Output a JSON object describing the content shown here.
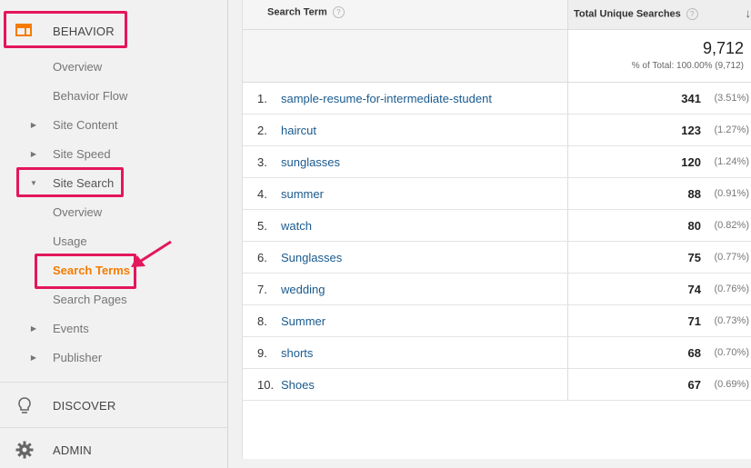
{
  "sidebar": {
    "behavior_label": "BEHAVIOR",
    "items": {
      "overview": "Overview",
      "behavior_flow": "Behavior Flow",
      "site_content": "Site Content",
      "site_speed": "Site Speed",
      "site_search": "Site Search",
      "ss_overview": "Overview",
      "usage": "Usage",
      "search_terms": "Search Terms",
      "search_pages": "Search Pages",
      "events": "Events",
      "publisher": "Publisher"
    },
    "discover_label": "DISCOVER",
    "admin_label": "ADMIN"
  },
  "table": {
    "col_term": "Search Term",
    "col_searches": "Total Unique Searches",
    "total_value": "9,712",
    "total_pct": "% of Total: 100.00% (9,712)",
    "rows": [
      {
        "idx": "1.",
        "term": "sample-resume-for-intermediate-student",
        "value": "341",
        "pct": "(3.51%)"
      },
      {
        "idx": "2.",
        "term": "haircut",
        "value": "123",
        "pct": "(1.27%)"
      },
      {
        "idx": "3.",
        "term": "sunglasses",
        "value": "120",
        "pct": "(1.24%)"
      },
      {
        "idx": "4.",
        "term": "summer",
        "value": "88",
        "pct": "(0.91%)"
      },
      {
        "idx": "5.",
        "term": "watch",
        "value": "80",
        "pct": "(0.82%)"
      },
      {
        "idx": "6.",
        "term": "Sunglasses",
        "value": "75",
        "pct": "(0.77%)"
      },
      {
        "idx": "7.",
        "term": "wedding",
        "value": "74",
        "pct": "(0.76%)"
      },
      {
        "idx": "8.",
        "term": "Summer",
        "value": "71",
        "pct": "(0.73%)"
      },
      {
        "idx": "9.",
        "term": "shorts",
        "value": "68",
        "pct": "(0.70%)"
      },
      {
        "idx": "10.",
        "term": "Shoes",
        "value": "67",
        "pct": "(0.69%)"
      }
    ]
  },
  "colors": {
    "highlight": "#e4165c",
    "active": "#f57c00",
    "link": "#1a5a8e"
  }
}
